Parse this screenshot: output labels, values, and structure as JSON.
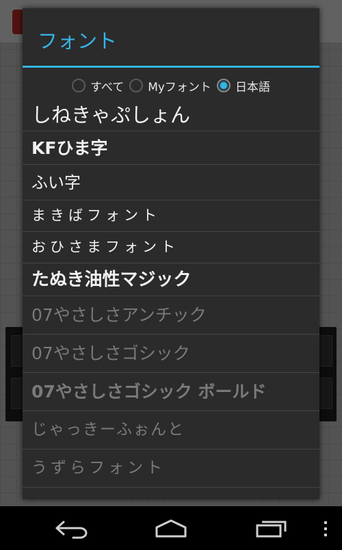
{
  "dialog": {
    "title": "フォント"
  },
  "filter": {
    "options": [
      {
        "label": "すべて",
        "selected": false
      },
      {
        "label": "Myフォント",
        "selected": false
      },
      {
        "label": "日本語",
        "selected": true
      }
    ]
  },
  "fonts": [
    {
      "label": "しねきゃぷしょん",
      "enabled": true
    },
    {
      "label": "KFひま字",
      "enabled": true
    },
    {
      "label": "ふい字",
      "enabled": true
    },
    {
      "label": "まきばフォント",
      "enabled": true
    },
    {
      "label": "おひさまフォント",
      "enabled": true
    },
    {
      "label": "たぬき油性マジック",
      "enabled": true
    },
    {
      "label": "07やさしさアンチック",
      "enabled": false
    },
    {
      "label": "07やさしさゴシック",
      "enabled": false
    },
    {
      "label": "07やさしさゴシック ボールド",
      "enabled": false
    },
    {
      "label": "じゃっきーふぉんと",
      "enabled": false
    },
    {
      "label": "うずらフォント",
      "enabled": false
    }
  ],
  "colors": {
    "accent": "#33b5e5",
    "enabled_text": "#f2f2f2",
    "disabled_text": "#7a7a7a"
  },
  "navbar": {
    "buttons": [
      "back-icon",
      "home-icon",
      "recent-apps-icon",
      "overflow-menu-icon"
    ]
  }
}
